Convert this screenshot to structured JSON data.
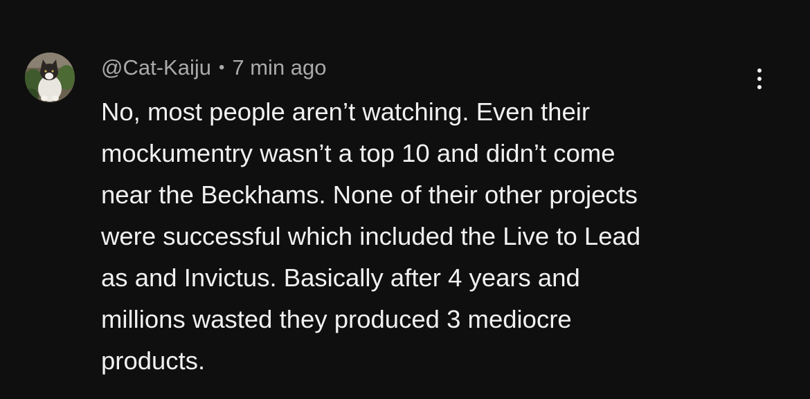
{
  "comment": {
    "author": "@Cat-Kaiju",
    "separator": "•",
    "timestamp": "7 min ago",
    "avatar_icon": "cat-photo-avatar",
    "menu_icon": "more-vertical-icon",
    "text_lines": [
      "No, most people aren’t watching. Even their",
      "mockumentry wasn’t a top 10 and didn’t come",
      "near the Beckhams. None of their other projects",
      "were successful which included the Live to Lead",
      "as and Invictus. Basically after 4 years and",
      "millions wasted they produced 3 mediocre",
      "products."
    ]
  },
  "colors": {
    "background": "#0f0f0f",
    "meta_text": "#aaaaaa",
    "body_text": "#f1f1f1"
  }
}
